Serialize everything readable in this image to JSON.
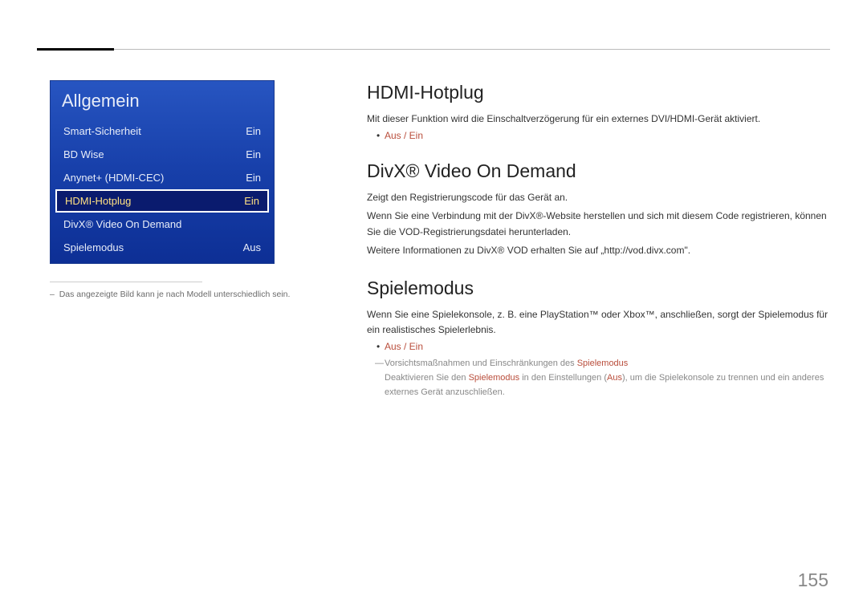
{
  "menu": {
    "title": "Allgemein",
    "items": [
      {
        "label": "Smart-Sicherheit",
        "value": "Ein",
        "selected": false
      },
      {
        "label": "BD Wise",
        "value": "Ein",
        "selected": false
      },
      {
        "label": "Anynet+ (HDMI-CEC)",
        "value": "Ein",
        "selected": false
      },
      {
        "label": "HDMI-Hotplug",
        "value": "Ein",
        "selected": true
      },
      {
        "label": "DivX® Video On Demand",
        "value": "",
        "selected": false
      },
      {
        "label": "Spielemodus",
        "value": "Aus",
        "selected": false
      }
    ],
    "caption_prefix": "–",
    "caption": "Das angezeigte Bild kann je nach Modell unterschiedlich sein."
  },
  "sections": {
    "hdmi": {
      "title": "HDMI-Hotplug",
      "desc": "Mit dieser Funktion wird die Einschaltverzögerung für ein externes DVI/HDMI-Gerät aktiviert.",
      "option": "Aus / Ein"
    },
    "divx": {
      "title": "DivX® Video On Demand",
      "line1": "Zeigt den Registrierungscode für das Gerät an.",
      "line2": "Wenn Sie eine Verbindung mit der DivX®-Website herstellen und sich mit diesem Code registrieren, können Sie die VOD-Registrierungsdatei herunterladen.",
      "line3": "Weitere Informationen zu DivX® VOD erhalten Sie auf „http://vod.divx.com\"."
    },
    "spiel": {
      "title": "Spielemodus",
      "desc": "Wenn Sie eine Spielekonsole, z. B. eine PlayStation™ oder Xbox™, anschließen, sorgt der Spielemodus für ein realistisches Spielerlebnis.",
      "option": "Aus / Ein",
      "note_prefix": "Vorsichtsmaßnahmen und Einschränkungen des ",
      "note_strong": "Spielemodus",
      "sub1a": "Deaktivieren Sie den ",
      "sub1b": "Spielemodus",
      "sub1c": " in den Einstellungen (",
      "sub1d": "Aus",
      "sub1e": "), um die Spielekonsole zu trennen und ein anderes externes Gerät anzuschließen."
    }
  },
  "page_number": "155"
}
